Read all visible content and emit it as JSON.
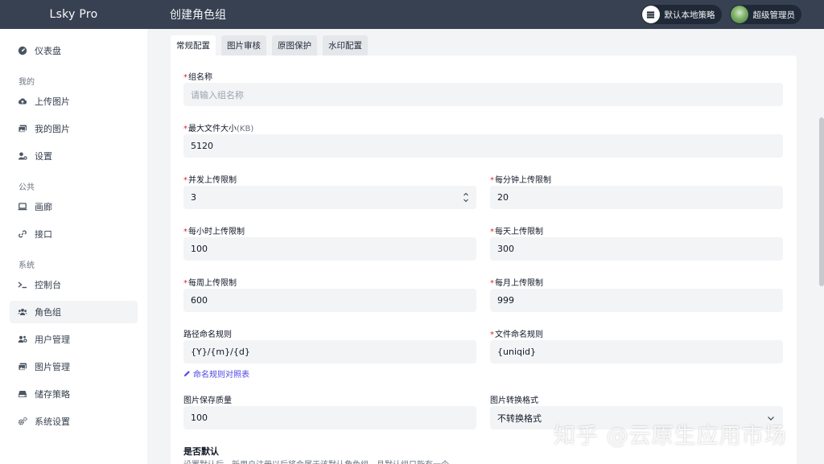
{
  "app": {
    "brand": "Lsky Pro",
    "page_title": "创建角色组"
  },
  "header": {
    "strategy_label": "默认本地策略",
    "user_name": "超级管理员"
  },
  "sidebar": {
    "dashboard": "仪表盘",
    "section_mine": "我的",
    "upload": "上传图片",
    "my_images": "我的图片",
    "settings": "设置",
    "section_public": "公共",
    "gallery": "画廊",
    "api": "接口",
    "section_system": "系统",
    "console": "控制台",
    "roles": "角色组",
    "users": "用户管理",
    "images": "图片管理",
    "storage": "储存策略",
    "system_settings": "系统设置"
  },
  "tabs": [
    "常规配置",
    "图片审核",
    "原图保护",
    "水印配置"
  ],
  "form": {
    "required_mark": "*",
    "group_name": {
      "label": "组名称",
      "placeholder": "请输入组名称"
    },
    "max_file_size": {
      "label": "最大文件大小",
      "unit": "(KB)",
      "value": "5120"
    },
    "concurrent_limit": {
      "label": "并发上传限制",
      "value": "3"
    },
    "per_minute_limit": {
      "label": "每分钟上传限制",
      "value": "20"
    },
    "per_hour_limit": {
      "label": "每小时上传限制",
      "value": "100"
    },
    "per_day_limit": {
      "label": "每天上传限制",
      "value": "300"
    },
    "per_week_limit": {
      "label": "每周上传限制",
      "value": "600"
    },
    "per_month_limit": {
      "label": "每月上传限制",
      "value": "999"
    },
    "path_rule": {
      "label": "路径命名规则",
      "value": "{Y}/{m}/{d}",
      "help": "命名规则对照表"
    },
    "file_rule": {
      "label": "文件命名规则",
      "value": "{uniqid}"
    },
    "quality": {
      "label": "图片保存质量",
      "value": "100"
    },
    "convert_format": {
      "label": "图片转换格式",
      "value": "不转换格式"
    },
    "is_default": {
      "title": "是否默认",
      "desc": "设置默认后，新用户注册以后将会属于该默认角色组，且默认组只能有一个。"
    }
  },
  "watermark": "知乎 @云原生应用市场",
  "colors": {
    "topbar": "#374151",
    "accent": "#4f46e5",
    "required": "#dc2626"
  }
}
